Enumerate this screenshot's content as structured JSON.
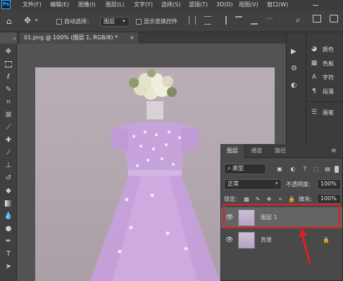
{
  "app": {
    "logo": "Ps"
  },
  "menu": [
    "文件(F)",
    "编辑(E)",
    "图像(I)",
    "图层(L)",
    "文字(Y)",
    "选择(S)",
    "滤镜(T)",
    "3D(D)",
    "视图(V)",
    "窗口(W)"
  ],
  "options_bar": {
    "auto_select_label": "自动选择：",
    "auto_select_value": "图层",
    "transform_controls_label": "显示变换控件"
  },
  "document": {
    "tab_title": "01.png @ 100% (图层 1, RGB/8) *",
    "close_glyph": "×"
  },
  "right_dock": {
    "panels": [
      {
        "icon": "color-icon",
        "label": "颜色"
      },
      {
        "icon": "swatches-icon",
        "label": "色板"
      },
      {
        "icon": "character-icon",
        "label": "字符"
      },
      {
        "icon": "paragraph-icon",
        "label": "段落"
      },
      {
        "icon": "brush-settings-icon",
        "label": "画笔"
      }
    ]
  },
  "layers_panel": {
    "tabs": [
      "图层",
      "通道",
      "路径"
    ],
    "active_tab": "图层",
    "filter_kind": "类型",
    "blend_mode": "正常",
    "opacity_label": "不透明度:",
    "opacity_value": "100%",
    "lock_label": "锁定:",
    "fill_label": "填充:",
    "fill_value": "100%",
    "layers": [
      {
        "name": "图层 1",
        "visible": true,
        "selected": true,
        "locked": false
      },
      {
        "name": "背景",
        "visible": true,
        "selected": false,
        "locked": true
      }
    ]
  },
  "colors": {
    "annotation": "#e02020",
    "dress": "#c79fdc"
  }
}
